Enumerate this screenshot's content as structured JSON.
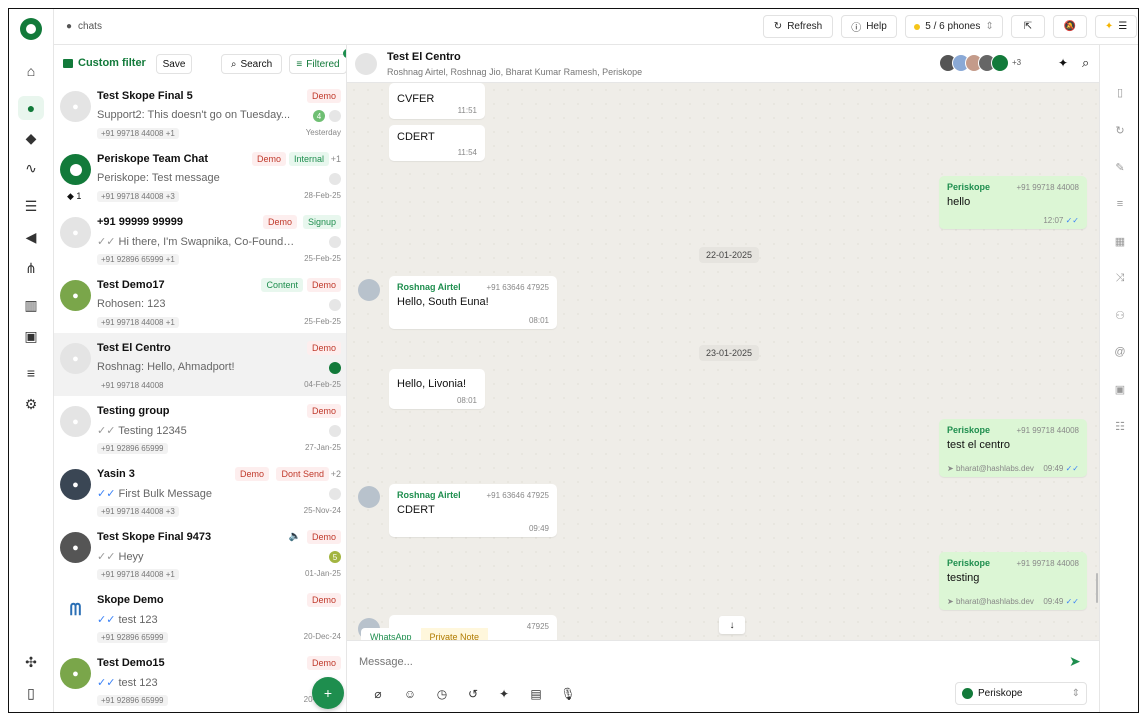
{
  "topbar": {
    "crumb": "chats",
    "refresh": "Refresh",
    "help": "Help",
    "phones": "5 / 6 phones"
  },
  "filter": {
    "custom": "Custom filter",
    "save": "Save",
    "search": "Search",
    "filtered": "Filtered"
  },
  "chats": [
    {
      "name": "Test Skope Final 5",
      "preview": "Support2: This doesn't go on Tuesday...",
      "phone": "+91 99718 44008 +1",
      "date": "Yesterday",
      "tags": [
        "Demo"
      ],
      "badge": "4"
    },
    {
      "name": "Periskope Team Chat",
      "preview": "Periskope: Test message",
      "phone": "+91 99718 44008 +3",
      "date": "28-Feb-25",
      "tags": [
        "Demo",
        "Internal"
      ],
      "plus": "+1",
      "count": "1"
    },
    {
      "name": "+91 99999 99999",
      "preview": "Hi there, I'm Swapnika, Co-Founder of ...",
      "phone": "+91 92896 65999 +1",
      "date": "25-Feb-25",
      "tags": [
        "Demo",
        "Signup"
      ]
    },
    {
      "name": "Test Demo17",
      "preview": "Rohosen: 123",
      "phone": "+91 99718 44008 +1",
      "date": "25-Feb-25",
      "tags": [
        "Content",
        "Demo"
      ]
    },
    {
      "name": "Test El Centro",
      "preview": "Roshnag: Hello, Ahmadport!",
      "phone": "+91 99718 44008",
      "date": "04-Feb-25",
      "tags": [
        "Demo"
      ]
    },
    {
      "name": "Testing group",
      "preview": "Testing 12345",
      "phone": "+91 92896 65999",
      "date": "27-Jan-25",
      "tags": [
        "Demo"
      ]
    },
    {
      "name": "Yasin 3",
      "preview": "First Bulk Message",
      "phone": "+91 99718 44008 +3",
      "date": "25-Nov-24",
      "tags": [
        "Demo",
        "Dont Send"
      ],
      "plus": "+2"
    },
    {
      "name": "Test Skope Final 9473",
      "preview": "Heyy",
      "phone": "+91 99718 44008 +1",
      "date": "01-Jan-25",
      "tags": [
        "Demo"
      ],
      "badge": "5"
    },
    {
      "name": "Skope Demo",
      "preview": "test 123",
      "phone": "+91 92896 65999",
      "date": "20-Dec-24",
      "tags": [
        "Demo"
      ]
    },
    {
      "name": "Test Demo15",
      "preview": "test 123",
      "phone": "+91 92896 65999",
      "date": "20-Dec-24",
      "tags": [
        "Demo"
      ]
    }
  ],
  "header": {
    "title": "Test El Centro",
    "subtitle": "Roshnag Airtel, Roshnag Jio, Bharat Kumar Ramesh, Periskope",
    "more": "+3"
  },
  "messages": {
    "m1": {
      "text": "CVFER",
      "time": "11:51"
    },
    "m2": {
      "text": "CDERT",
      "time": "11:54"
    },
    "m3": {
      "who": "Periskope",
      "num": "+91 99718 44008",
      "text": "hello",
      "time": "12:07"
    },
    "d1": "22-01-2025",
    "m4": {
      "who": "Roshnag Airtel",
      "num": "+91 63646 47925",
      "text": "Hello, South Euna!",
      "time": "08:01"
    },
    "d2": "23-01-2025",
    "m5": {
      "text": "Hello, Livonia!",
      "time": "08:01"
    },
    "m6": {
      "who": "Periskope",
      "num": "+91 99718 44008",
      "text": "test el centro",
      "email": "bharat@hashlabs.dev",
      "time": "09:49"
    },
    "m7": {
      "who": "Roshnag Airtel",
      "num": "+91 63646 47925",
      "text": "CDERT",
      "time": "09:49"
    },
    "m8": {
      "who": "Periskope",
      "num": "+91 99718 44008",
      "text": "testing",
      "email": "bharat@hashlabs.dev",
      "time": "09:49"
    },
    "m9": {
      "num": "47925"
    }
  },
  "composer": {
    "tab_whatsapp": "WhatsApp",
    "tab_note": "Private Note",
    "placeholder": "Message...",
    "sender": "Periskope"
  }
}
